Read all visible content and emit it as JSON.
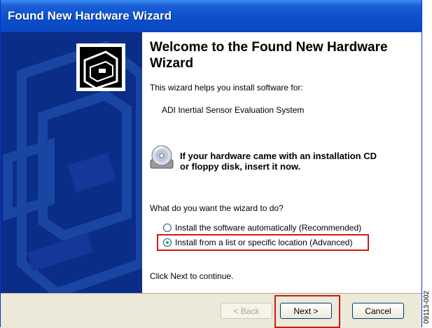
{
  "window": {
    "title": "Found New Hardware Wizard"
  },
  "content": {
    "welcome_title": "Welcome to the Found New Hardware Wizard",
    "intro": "This wizard helps you install software for:",
    "device_name": "ADI Inertial Sensor Evaluation System",
    "cd_hint_line1": "If your hardware came with an installation CD",
    "cd_hint_line2": "or floppy disk, insert it now.",
    "question": "What do you want the wizard to do?",
    "options": [
      {
        "label": "Install the software automatically (Recommended)",
        "checked": false
      },
      {
        "label": "Install from a list or specific location (Advanced)",
        "checked": true
      }
    ],
    "continue_text": "Click Next to continue."
  },
  "footer": {
    "back_label": "< Back",
    "next_label": "Next >",
    "cancel_label": "Cancel"
  },
  "figure_id": "09113-002",
  "highlight_color": "#d01818"
}
